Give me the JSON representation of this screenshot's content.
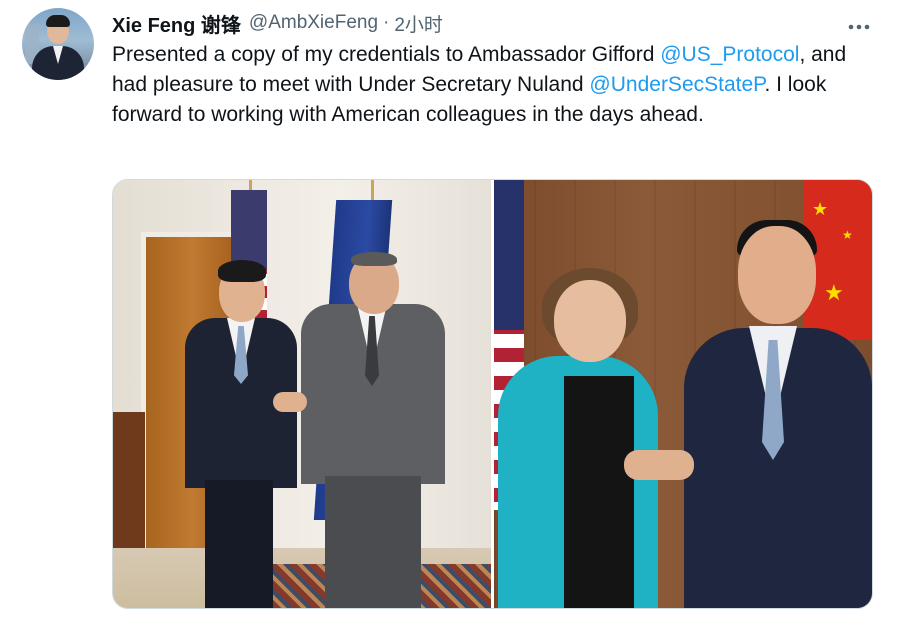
{
  "author": {
    "display_name": "Xie Feng 谢锋",
    "handle": "@AmbXieFeng",
    "separator": "·",
    "time": "2小时"
  },
  "more_menu_icon": "more-horizontal-icon",
  "tweet_text": {
    "part1": "Presented a copy of my credentials to Ambassador Gifford ",
    "mention1": "@US_Protocol",
    "part2": ", and had pleasure to meet with Under Secretary Nuland ",
    "mention2": "@UnderSecStateP",
    "part3": ". I look forward to working with American colleagues in the days ahead."
  },
  "colors": {
    "mention": "#1d9bf0",
    "secondary_text": "#536471",
    "primary_text": "#0f1419"
  },
  "media": {
    "count": 2
  }
}
